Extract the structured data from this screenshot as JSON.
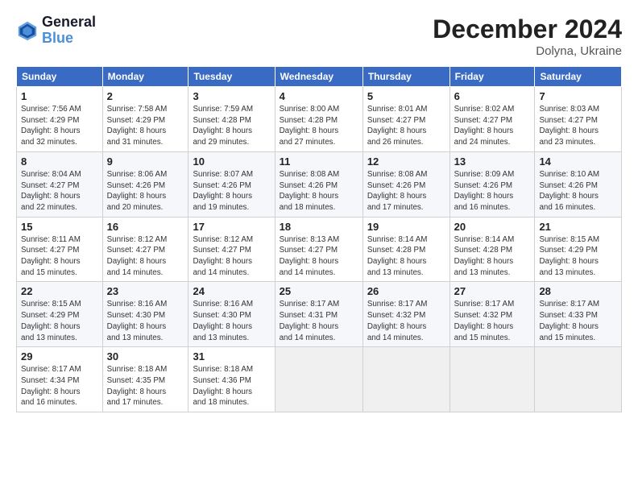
{
  "header": {
    "logo_line1": "General",
    "logo_line2": "Blue",
    "month": "December 2024",
    "location": "Dolyna, Ukraine"
  },
  "weekdays": [
    "Sunday",
    "Monday",
    "Tuesday",
    "Wednesday",
    "Thursday",
    "Friday",
    "Saturday"
  ],
  "weeks": [
    [
      {
        "day": "1",
        "info": "Sunrise: 7:56 AM\nSunset: 4:29 PM\nDaylight: 8 hours\nand 32 minutes."
      },
      {
        "day": "2",
        "info": "Sunrise: 7:58 AM\nSunset: 4:29 PM\nDaylight: 8 hours\nand 31 minutes."
      },
      {
        "day": "3",
        "info": "Sunrise: 7:59 AM\nSunset: 4:28 PM\nDaylight: 8 hours\nand 29 minutes."
      },
      {
        "day": "4",
        "info": "Sunrise: 8:00 AM\nSunset: 4:28 PM\nDaylight: 8 hours\nand 27 minutes."
      },
      {
        "day": "5",
        "info": "Sunrise: 8:01 AM\nSunset: 4:27 PM\nDaylight: 8 hours\nand 26 minutes."
      },
      {
        "day": "6",
        "info": "Sunrise: 8:02 AM\nSunset: 4:27 PM\nDaylight: 8 hours\nand 24 minutes."
      },
      {
        "day": "7",
        "info": "Sunrise: 8:03 AM\nSunset: 4:27 PM\nDaylight: 8 hours\nand 23 minutes."
      }
    ],
    [
      {
        "day": "8",
        "info": "Sunrise: 8:04 AM\nSunset: 4:27 PM\nDaylight: 8 hours\nand 22 minutes."
      },
      {
        "day": "9",
        "info": "Sunrise: 8:06 AM\nSunset: 4:26 PM\nDaylight: 8 hours\nand 20 minutes."
      },
      {
        "day": "10",
        "info": "Sunrise: 8:07 AM\nSunset: 4:26 PM\nDaylight: 8 hours\nand 19 minutes."
      },
      {
        "day": "11",
        "info": "Sunrise: 8:08 AM\nSunset: 4:26 PM\nDaylight: 8 hours\nand 18 minutes."
      },
      {
        "day": "12",
        "info": "Sunrise: 8:08 AM\nSunset: 4:26 PM\nDaylight: 8 hours\nand 17 minutes."
      },
      {
        "day": "13",
        "info": "Sunrise: 8:09 AM\nSunset: 4:26 PM\nDaylight: 8 hours\nand 16 minutes."
      },
      {
        "day": "14",
        "info": "Sunrise: 8:10 AM\nSunset: 4:26 PM\nDaylight: 8 hours\nand 16 minutes."
      }
    ],
    [
      {
        "day": "15",
        "info": "Sunrise: 8:11 AM\nSunset: 4:27 PM\nDaylight: 8 hours\nand 15 minutes."
      },
      {
        "day": "16",
        "info": "Sunrise: 8:12 AM\nSunset: 4:27 PM\nDaylight: 8 hours\nand 14 minutes."
      },
      {
        "day": "17",
        "info": "Sunrise: 8:12 AM\nSunset: 4:27 PM\nDaylight: 8 hours\nand 14 minutes."
      },
      {
        "day": "18",
        "info": "Sunrise: 8:13 AM\nSunset: 4:27 PM\nDaylight: 8 hours\nand 14 minutes."
      },
      {
        "day": "19",
        "info": "Sunrise: 8:14 AM\nSunset: 4:28 PM\nDaylight: 8 hours\nand 13 minutes."
      },
      {
        "day": "20",
        "info": "Sunrise: 8:14 AM\nSunset: 4:28 PM\nDaylight: 8 hours\nand 13 minutes."
      },
      {
        "day": "21",
        "info": "Sunrise: 8:15 AM\nSunset: 4:29 PM\nDaylight: 8 hours\nand 13 minutes."
      }
    ],
    [
      {
        "day": "22",
        "info": "Sunrise: 8:15 AM\nSunset: 4:29 PM\nDaylight: 8 hours\nand 13 minutes."
      },
      {
        "day": "23",
        "info": "Sunrise: 8:16 AM\nSunset: 4:30 PM\nDaylight: 8 hours\nand 13 minutes."
      },
      {
        "day": "24",
        "info": "Sunrise: 8:16 AM\nSunset: 4:30 PM\nDaylight: 8 hours\nand 13 minutes."
      },
      {
        "day": "25",
        "info": "Sunrise: 8:17 AM\nSunset: 4:31 PM\nDaylight: 8 hours\nand 14 minutes."
      },
      {
        "day": "26",
        "info": "Sunrise: 8:17 AM\nSunset: 4:32 PM\nDaylight: 8 hours\nand 14 minutes."
      },
      {
        "day": "27",
        "info": "Sunrise: 8:17 AM\nSunset: 4:32 PM\nDaylight: 8 hours\nand 15 minutes."
      },
      {
        "day": "28",
        "info": "Sunrise: 8:17 AM\nSunset: 4:33 PM\nDaylight: 8 hours\nand 15 minutes."
      }
    ],
    [
      {
        "day": "29",
        "info": "Sunrise: 8:17 AM\nSunset: 4:34 PM\nDaylight: 8 hours\nand 16 minutes."
      },
      {
        "day": "30",
        "info": "Sunrise: 8:18 AM\nSunset: 4:35 PM\nDaylight: 8 hours\nand 17 minutes."
      },
      {
        "day": "31",
        "info": "Sunrise: 8:18 AM\nSunset: 4:36 PM\nDaylight: 8 hours\nand 18 minutes."
      },
      null,
      null,
      null,
      null
    ]
  ]
}
